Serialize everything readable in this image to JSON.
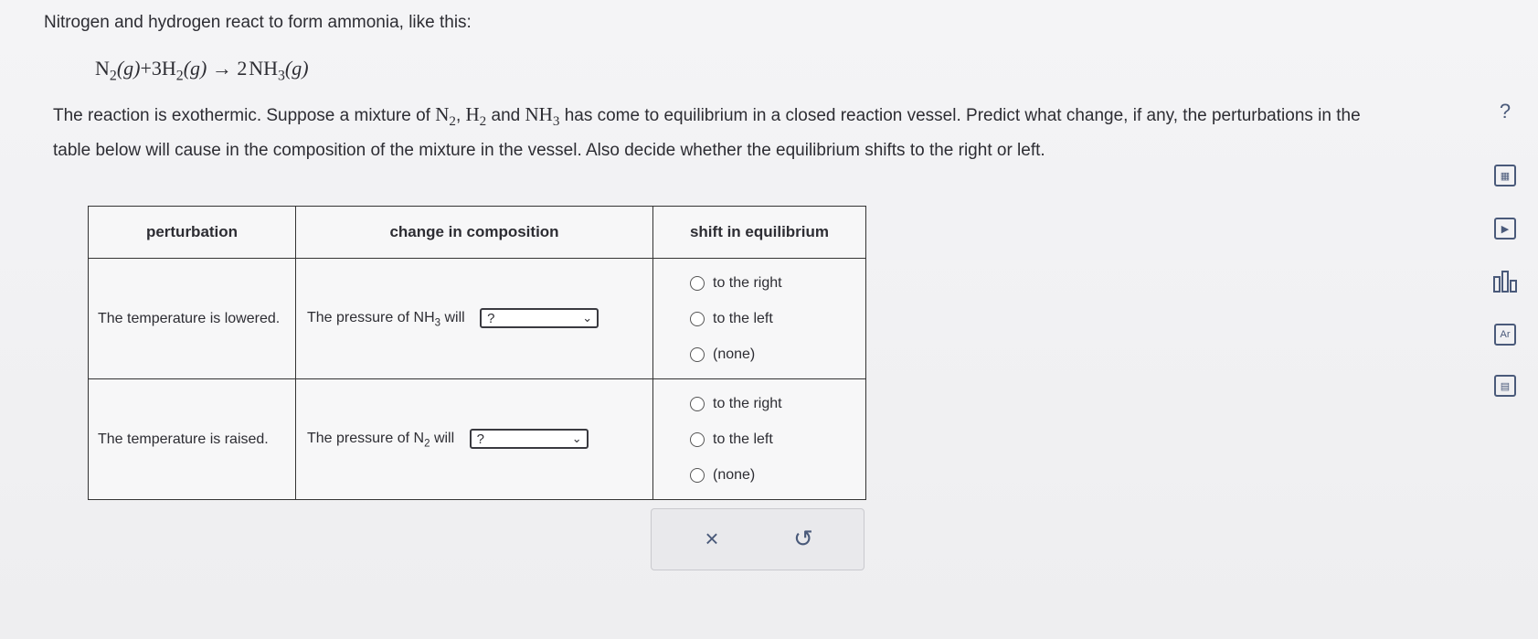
{
  "intro": "Nitrogen and hydrogen react to form ammonia, like this:",
  "equation": {
    "reactant1": "N",
    "r1_sub": "2",
    "r1_state": "(g)",
    "plus": "+",
    "coef2": "3",
    "reactant2": "H",
    "r2_sub": "2",
    "r2_state": "(g)",
    "arrow": "→",
    "coef3": "2",
    "product": "NH",
    "p_sub": "3",
    "p_state": "(g)"
  },
  "question": {
    "part1": "The reaction is exothermic. Suppose a mixture of",
    "n2": "N",
    "n2_sub": "2",
    "comma1": ",",
    "h2": "H",
    "h2_sub": "2",
    "and": "and",
    "nh3": "NH",
    "nh3_sub": "3",
    "part2": "has come to equilibrium in a closed reaction vessel. Predict what change, if any, the perturbations in the table below will cause in the composition of the mixture in the vessel. Also decide whether the equilibrium shifts to the right or left."
  },
  "table": {
    "headers": [
      "perturbation",
      "change in composition",
      "shift in equilibrium"
    ],
    "rows": [
      {
        "perturbation": "The temperature is lowered.",
        "change_prefix": "The pressure of",
        "species": "NH",
        "species_sub": "3",
        "change_suffix": "will",
        "select_value": "?",
        "options": [
          "to the right",
          "to the left",
          "(none)"
        ]
      },
      {
        "perturbation": "The temperature is raised.",
        "change_prefix": "The pressure of",
        "species": "N",
        "species_sub": "2",
        "change_suffix": "will",
        "select_value": "?",
        "options": [
          "to the right",
          "to the left",
          "(none)"
        ]
      }
    ]
  },
  "actions": {
    "clear_icon": "×",
    "undo_icon": "↺"
  },
  "sidebar": {
    "help_icon": "?",
    "icons": [
      "calculator-icon",
      "video-icon",
      "chart-icon",
      "periodic-table-icon",
      "reference-icon"
    ],
    "periodic_label": "Ar"
  }
}
